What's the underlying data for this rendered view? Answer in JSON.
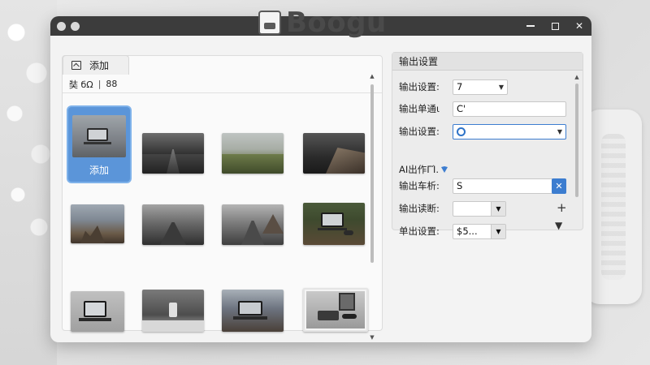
{
  "app": {
    "logo_text": "Boogu"
  },
  "window": {
    "controls": {
      "minimize": "—",
      "maximize": "□",
      "close": "✕"
    }
  },
  "left_panel": {
    "tab_label": "添加",
    "filter_text_a": "奘 бΩ",
    "filter_separator": "|",
    "filter_text_b": "88",
    "selected_label": "添加"
  },
  "right_panel": {
    "header": "输出设置",
    "rows": {
      "r1_label": "输出设置:",
      "r1_value": "7",
      "r2_label": "输出单通ι",
      "r2_value": "C'",
      "r3_label": "输出设置:",
      "ai_label": "AI出作ΓΊ.",
      "r4_label": "输出车析:",
      "r4_value": "S",
      "r4_clear": "✕",
      "r5_label": "输出读断:",
      "r5_plus": "+",
      "r6_label": "单出设置:",
      "r6_value": "$5...\u0001\u0001"
    }
  },
  "colors": {
    "accent": "#5b95d9",
    "titlebar": "#3c3c3c",
    "window_bg": "#f3f3f3"
  },
  "icons": {
    "tab_icon": "image-icon",
    "ai_icon": "shield-icon",
    "r3_icon": "circle-icon"
  }
}
